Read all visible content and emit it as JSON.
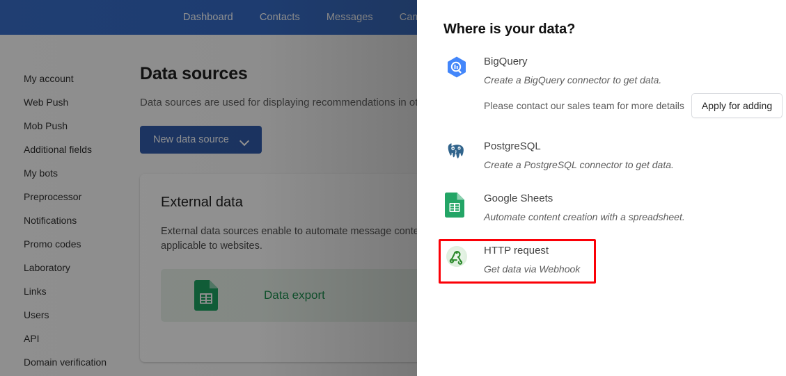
{
  "topnav": {
    "items": [
      {
        "label": "Dashboard"
      },
      {
        "label": "Contacts"
      },
      {
        "label": "Messages"
      },
      {
        "label": "Campaigns"
      }
    ],
    "bg_color": "#2a63c4"
  },
  "sidebar": {
    "items": [
      {
        "label": "My account"
      },
      {
        "label": "Web Push"
      },
      {
        "label": "Mob Push"
      },
      {
        "label": "Additional fields"
      },
      {
        "label": "My bots"
      },
      {
        "label": "Preprocessor"
      },
      {
        "label": "Notifications"
      },
      {
        "label": "Promo codes"
      },
      {
        "label": "Laboratory"
      },
      {
        "label": "Links"
      },
      {
        "label": "Users"
      },
      {
        "label": "API"
      },
      {
        "label": "Domain verification"
      }
    ]
  },
  "main": {
    "title": "Data sources",
    "description": "Data sources are used for displaying recommendations in ot sources",
    "new_data_source_button": "New data source",
    "chevron_icon": "chevron-down-icon",
    "card": {
      "title": "External data",
      "description": "External data sources enable to automate message content only, and aren't applicable to websites.",
      "export_item": {
        "label": "Data export",
        "icon": "google-sheets-icon",
        "bg_color": "#e8f2ea",
        "text_color": "#0f8a45"
      }
    }
  },
  "panel": {
    "title": "Where is your data?",
    "sources": [
      {
        "name": "BigQuery",
        "description": "Create a BigQuery connector to get data.",
        "note": "Please contact our sales team for more details",
        "action_label": "Apply for adding",
        "icon": "bigquery-icon",
        "icon_color": "#4285f4"
      },
      {
        "name": "PostgreSQL",
        "description": "Create a PostgreSQL connector to get data.",
        "icon": "postgresql-elephant-icon",
        "icon_color": "#31648c"
      },
      {
        "name": "Google Sheets",
        "description": "Automate content creation with a spreadsheet.",
        "icon": "google-sheets-icon",
        "icon_color": "#23a566"
      },
      {
        "name": "HTTP request",
        "description": "Get data via Webhook",
        "icon": "webhook-icon",
        "icon_color": "#2d8a2d",
        "highlighted": true,
        "highlight_color": "#fb0007"
      }
    ]
  }
}
